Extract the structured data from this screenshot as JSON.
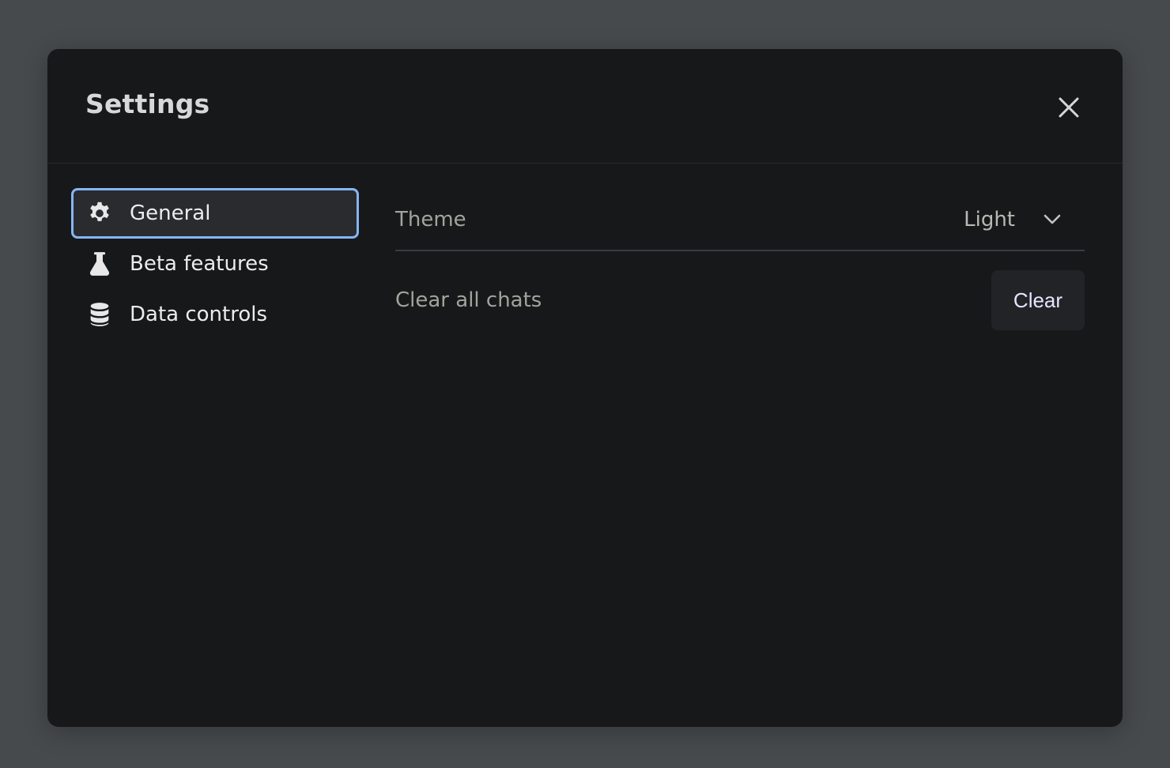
{
  "modal": {
    "title": "Settings",
    "close_icon": "close-icon"
  },
  "sidebar": {
    "items": [
      {
        "label": "General",
        "icon": "gear-icon",
        "active": true
      },
      {
        "label": "Beta features",
        "icon": "flask-icon",
        "active": false
      },
      {
        "label": "Data controls",
        "icon": "database-icon",
        "active": false
      }
    ]
  },
  "general": {
    "theme": {
      "label": "Theme",
      "value": "Light",
      "icon": "chevron-down-icon"
    },
    "clear_chats": {
      "label": "Clear all chats",
      "button_label": "Clear"
    }
  },
  "colors": {
    "backdrop": "#464a4d",
    "modal_bg": "#17181a",
    "active_border": "#86b5f5",
    "active_bg": "#2a2b2f",
    "clear_button_bg": "#222327"
  }
}
